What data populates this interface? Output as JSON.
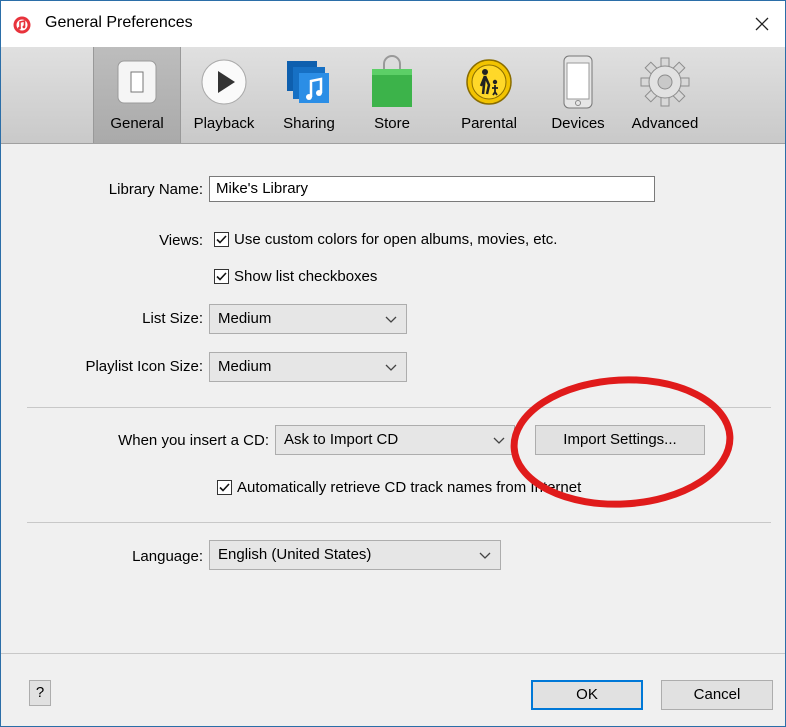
{
  "window": {
    "title": "General Preferences"
  },
  "toolbar": {
    "items": [
      {
        "label": "General",
        "icon": "general-switch-icon",
        "selected": true
      },
      {
        "label": "Playback",
        "icon": "play-icon"
      },
      {
        "label": "Sharing",
        "icon": "music-note-icon"
      },
      {
        "label": "Store",
        "icon": "shopping-bag-icon"
      },
      {
        "label": "Parental",
        "icon": "parental-icon"
      },
      {
        "label": "Devices",
        "icon": "phone-icon"
      },
      {
        "label": "Advanced",
        "icon": "gear-icon"
      }
    ]
  },
  "form": {
    "library_name_label": "Library Name:",
    "library_name_value": "Mike's Library",
    "views_label": "Views:",
    "views_option_1": "Use custom colors for open albums, movies, etc.",
    "views_option_1_checked": true,
    "views_option_2": "Show list checkboxes",
    "views_option_2_checked": true,
    "list_size_label": "List Size:",
    "list_size_value": "Medium",
    "playlist_icon_size_label": "Playlist Icon Size:",
    "playlist_icon_size_value": "Medium",
    "insert_cd_label": "When you insert a CD:",
    "insert_cd_value": "Ask to Import CD",
    "import_settings_label": "Import Settings...",
    "auto_retrieve_label": "Automatically retrieve CD track names from Internet",
    "auto_retrieve_checked": true,
    "language_label": "Language:",
    "language_value": "English (United States)"
  },
  "footer": {
    "help_label": "?",
    "ok_label": "OK",
    "cancel_label": "Cancel"
  },
  "colors": {
    "accent": "#0078d7",
    "annotation": "#e01b1b",
    "store_green": "#3cb34a",
    "sharing_blue": "#1e7fd6",
    "parental_yellow": "#f2c300"
  }
}
